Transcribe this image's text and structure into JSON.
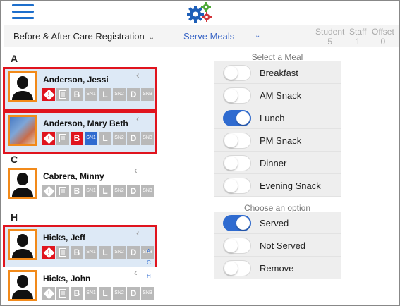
{
  "header": {
    "program": "Before & After Care Registration",
    "mode": "Serve Meals",
    "counters": [
      {
        "label": "Student",
        "value": "5"
      },
      {
        "label": "Staff",
        "value": "1"
      },
      {
        "label": "Offset",
        "value": "0"
      }
    ]
  },
  "colors": {
    "accent": "#2f6bd0",
    "alert": "#e0141e",
    "avatar_border": "#f28a1a",
    "selected_bg": "#dde9f6"
  },
  "sections": [
    "A",
    "C",
    "H"
  ],
  "students": [
    {
      "name": "Anderson, Jessi",
      "selected": true,
      "badges": [
        "!",
        "doc",
        "B",
        "SN1",
        "L",
        "SN2",
        "D",
        "SN3"
      ]
    },
    {
      "name": "Anderson, Mary Beth",
      "selected": true,
      "badges": [
        "!",
        "doc",
        "B",
        "SN1",
        "L",
        "SN2",
        "D",
        "SN3"
      ]
    },
    {
      "name": "Cabrera, Minny",
      "selected": false,
      "badges": [
        "!",
        "doc",
        "B",
        "SN1",
        "L",
        "SN2",
        "D",
        "SN3"
      ]
    },
    {
      "name": "Hicks, Jeff",
      "selected": true,
      "badges": [
        "!",
        "doc",
        "B",
        "SN1",
        "L",
        "SN2",
        "D",
        "SN3"
      ]
    },
    {
      "name": "Hicks, John",
      "selected": false,
      "badges": [
        "!",
        "doc",
        "B",
        "SN1",
        "L",
        "SN2",
        "D",
        "SN3"
      ]
    }
  ],
  "index_letters": [
    "A",
    "C",
    "H"
  ],
  "meals": {
    "title": "Select a Meal",
    "options": [
      {
        "label": "Breakfast",
        "on": false
      },
      {
        "label": "AM Snack",
        "on": false
      },
      {
        "label": "Lunch",
        "on": true
      },
      {
        "label": "PM Snack",
        "on": false
      },
      {
        "label": "Dinner",
        "on": false
      },
      {
        "label": "Evening Snack",
        "on": false
      }
    ]
  },
  "status": {
    "title": "Choose an option",
    "options": [
      {
        "label": "Served",
        "on": true
      },
      {
        "label": "Not Served",
        "on": false
      },
      {
        "label": "Remove",
        "on": false
      }
    ]
  }
}
